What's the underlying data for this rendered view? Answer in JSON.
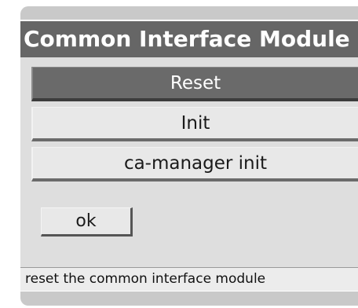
{
  "dialog": {
    "title": "Common Interface Module"
  },
  "menu": {
    "items": [
      {
        "label": "Reset",
        "selected": true
      },
      {
        "label": "Init",
        "selected": false
      },
      {
        "label": "ca-manager init",
        "selected": false
      }
    ]
  },
  "ok_button": {
    "label": "ok"
  },
  "status": {
    "text": "reset the common interface module"
  },
  "colors": {
    "title_bar": "#666666",
    "selected_item": "#6a6a6a",
    "panel": "#dedede",
    "button_face": "#e8e8e8"
  }
}
